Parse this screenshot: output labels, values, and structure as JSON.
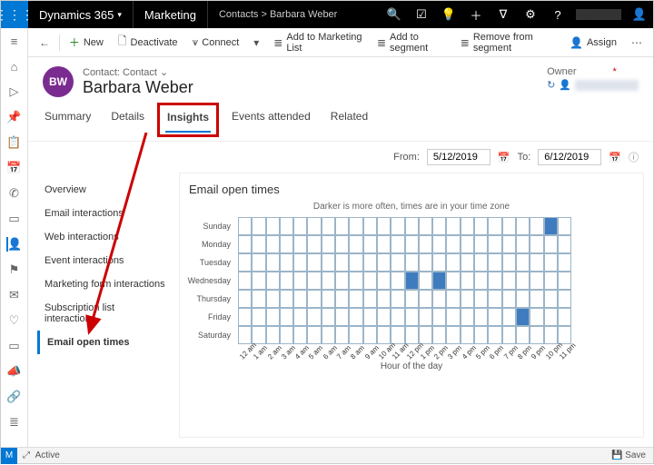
{
  "topbar": {
    "product": "Dynamics 365",
    "area": "Marketing",
    "breadcrumb_parent": "Contacts",
    "breadcrumb_current": "Barbara Weber"
  },
  "commands": {
    "new": "New",
    "deactivate": "Deactivate",
    "connect": "Connect",
    "add_marketing": "Add to Marketing List",
    "add_segment": "Add to segment",
    "remove_segment": "Remove from segment",
    "assign": "Assign"
  },
  "header": {
    "avatar_initials": "BW",
    "entity_label": "Contact: Contact",
    "name": "Barbara Weber",
    "owner_label": "Owner"
  },
  "tabs": {
    "summary": "Summary",
    "details": "Details",
    "insights": "Insights",
    "events": "Events attended",
    "related": "Related",
    "active": "insights"
  },
  "daterange": {
    "from_label": "From:",
    "from": "5/12/2019",
    "to_label": "To:",
    "to": "6/12/2019"
  },
  "sidemenu": {
    "items": [
      {
        "id": "overview",
        "label": "Overview"
      },
      {
        "id": "email",
        "label": "Email interactions"
      },
      {
        "id": "web",
        "label": "Web interactions"
      },
      {
        "id": "event",
        "label": "Event interactions"
      },
      {
        "id": "form",
        "label": "Marketing form interactions"
      },
      {
        "id": "subscription",
        "label": "Subscription list interactions"
      },
      {
        "id": "opentimes",
        "label": "Email open times"
      }
    ],
    "active": "opentimes"
  },
  "panel": {
    "title": "Email open times",
    "subtitle": "Darker is more often, times are in your time zone",
    "x_axis": "Hour of the day"
  },
  "footer": {
    "status": "Active",
    "save": "Save",
    "badge": "M"
  },
  "chart_data": {
    "type": "heatmap",
    "title": "Email open times",
    "subtitle": "Darker is more often, times are in your time zone",
    "xlabel": "Hour of the day",
    "ylabel": "",
    "y_categories": [
      "Sunday",
      "Monday",
      "Tuesday",
      "Wednesday",
      "Thursday",
      "Friday",
      "Saturday"
    ],
    "x_categories": [
      "12 am",
      "1 am",
      "2 am",
      "3 am",
      "4 am",
      "5 am",
      "6 am",
      "7 am",
      "8 am",
      "9 am",
      "10 am",
      "11 am",
      "12 pm",
      "1 pm",
      "2 pm",
      "3 pm",
      "4 pm",
      "5 pm",
      "6 pm",
      "7 pm",
      "8 pm",
      "9 pm",
      "10 pm",
      "11 pm"
    ],
    "cells": [
      {
        "day": "Sunday",
        "hour": "10 pm",
        "value": 1
      },
      {
        "day": "Wednesday",
        "hour": "12 pm",
        "value": 1
      },
      {
        "day": "Wednesday",
        "hour": "2 pm",
        "value": 1
      },
      {
        "day": "Friday",
        "hour": "8 pm",
        "value": 1
      }
    ]
  }
}
